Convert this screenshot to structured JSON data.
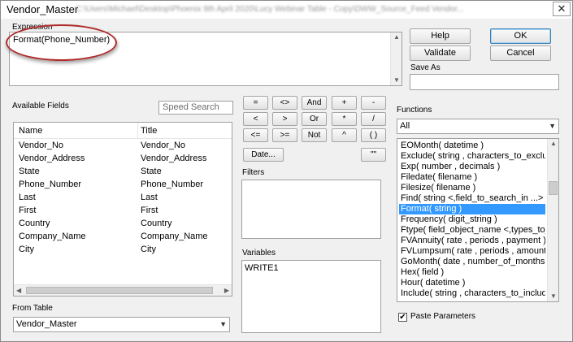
{
  "window": {
    "title": "Vendor_Master",
    "path_blurred": "C:\\Users\\Michael\\Desktop\\Phoenix 9th April 2020\\Lucy Webinar Table - Copy\\DWW_Source_Feed Vendor...",
    "close": "✕"
  },
  "expression": {
    "label": "Expression",
    "value": "Format(Phone_Number)"
  },
  "buttons": {
    "help": "Help",
    "ok": "OK",
    "validate": "Validate",
    "cancel": "Cancel",
    "date": "Date..."
  },
  "save_as": {
    "label": "Save As",
    "value": ""
  },
  "available_fields": {
    "label": "Available Fields",
    "search_placeholder": "Speed Search",
    "columns": [
      "Name",
      "Title"
    ],
    "rows": [
      [
        "Vendor_No",
        "Vendor_No"
      ],
      [
        "Vendor_Address",
        "Vendor_Address"
      ],
      [
        "State",
        "State"
      ],
      [
        "Phone_Number",
        "Phone_Number"
      ],
      [
        "Last",
        "Last"
      ],
      [
        "First",
        "First"
      ],
      [
        "Country",
        "Country"
      ],
      [
        "Company_Name",
        "Company_Name"
      ],
      [
        "City",
        "City"
      ]
    ]
  },
  "from_table": {
    "label": "From Table",
    "value": "Vendor_Master"
  },
  "operators": {
    "row1": [
      "=",
      "<>",
      "And",
      "+",
      "-"
    ],
    "row2": [
      "<",
      ">",
      "Or",
      "*",
      "/"
    ],
    "row3": [
      "<=",
      ">=",
      "Not",
      "^",
      "( )"
    ],
    "quote": "\"\""
  },
  "filters": {
    "label": "Filters"
  },
  "variables": {
    "label": "Variables",
    "items": [
      "WRITE1"
    ]
  },
  "functions": {
    "label": "Functions",
    "category": "All",
    "items": [
      "EOMonth( datetime )",
      "Exclude( string , characters_to_exclude",
      "Exp( number , decimals )",
      "Filedate( filename )",
      "Filesize( filename )",
      "Find( string <,field_to_search_in ...> )",
      "Format( string )",
      "Frequency( digit_string )",
      "Ftype( field_object_name <,types_to_a",
      "FVAnnuity( rate , periods , payment )",
      "FVLumpsum( rate , periods , amount )",
      "GoMonth( date , number_of_months )",
      "Hex( field )",
      "Hour( datetime )",
      "Include( string , characters_to_include"
    ],
    "selected_index": 6
  },
  "paste_parameters": {
    "label": "Paste Parameters",
    "checked": true
  },
  "colors": {
    "selection": "#3399ff",
    "annotation": "#b02a2a"
  }
}
